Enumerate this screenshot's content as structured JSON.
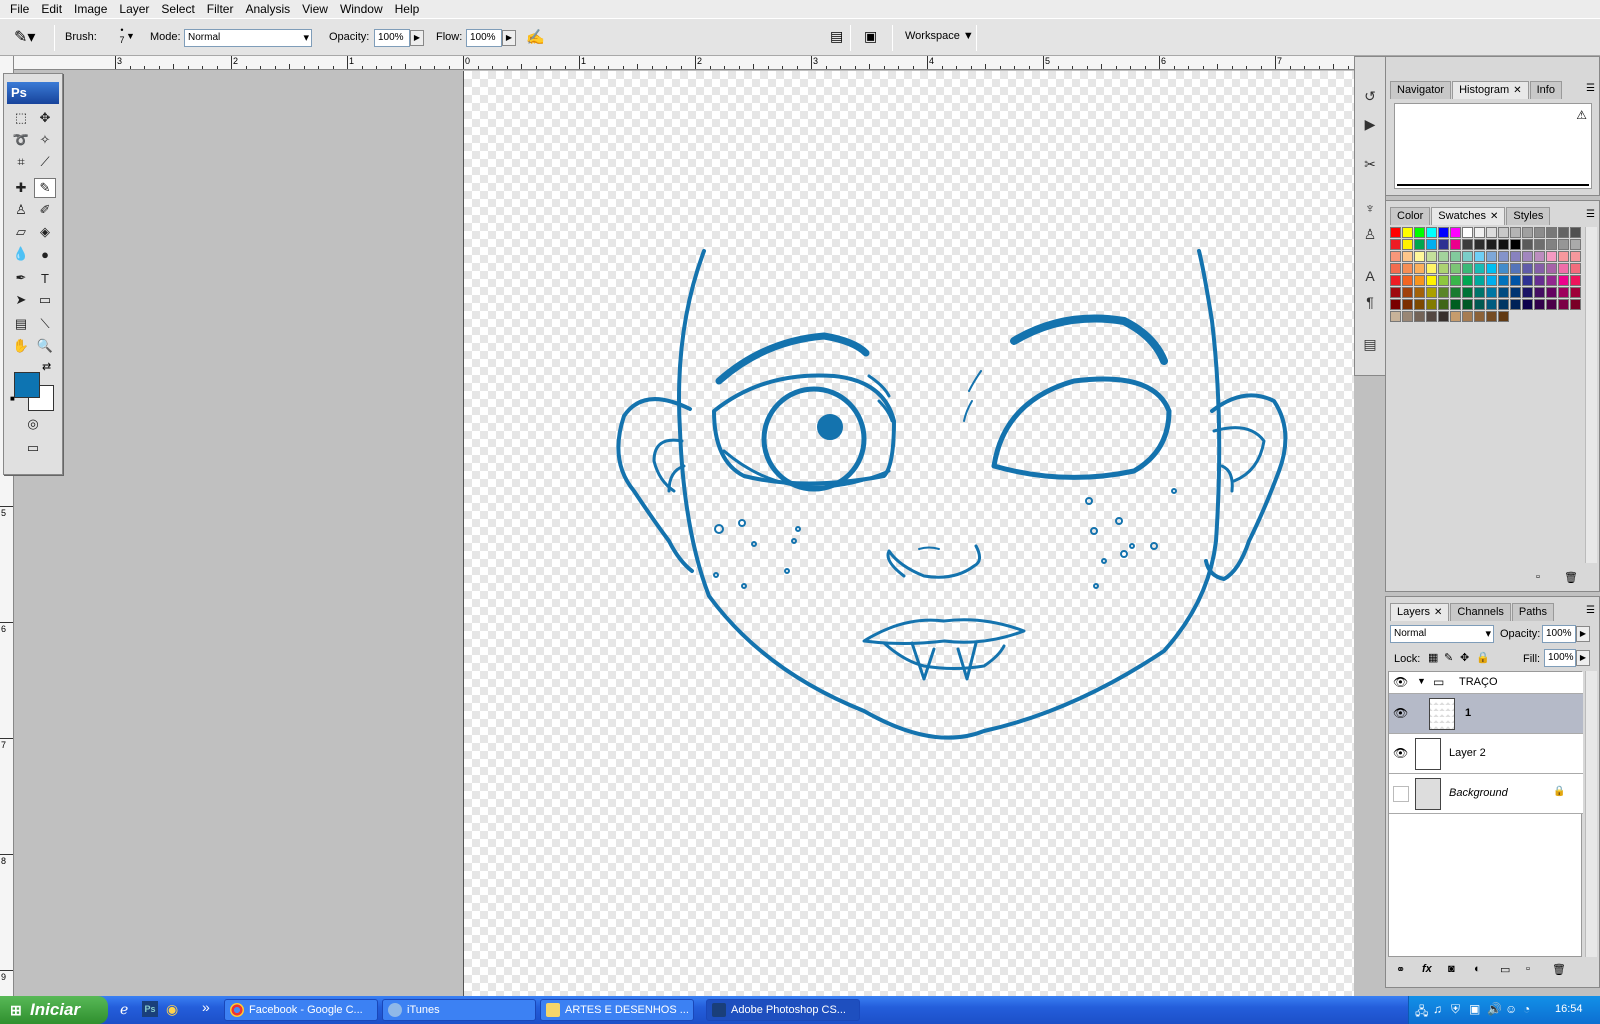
{
  "menu": [
    "File",
    "Edit",
    "Image",
    "Layer",
    "Select",
    "Filter",
    "Analysis",
    "View",
    "Window",
    "Help"
  ],
  "options": {
    "brush_label": "Brush:",
    "brush_size": "7",
    "mode_label": "Mode:",
    "mode_value": "Normal",
    "opacity_label": "Opacity:",
    "opacity_value": "100%",
    "flow_label": "Flow:",
    "flow_value": "100%",
    "workspace_label": "Workspace"
  },
  "rulers": {
    "h_labels": [
      "3",
      "2",
      "1",
      "0",
      "1",
      "2",
      "3",
      "4",
      "5",
      "6",
      "7"
    ],
    "v_labels": [
      "5",
      "6",
      "7",
      "8",
      "9"
    ]
  },
  "toolbox": {
    "logo": "Ps",
    "foreground_color": "#0d74b2",
    "background_color": "#ffffff"
  },
  "drawing": {
    "stroke_color": "#1473ae"
  },
  "panels": {
    "top_tabs": [
      "Navigator",
      "Histogram",
      "Info"
    ],
    "color_tabs": [
      "Color",
      "Swatches",
      "Styles"
    ],
    "layers_tabs": [
      "Layers",
      "Channels",
      "Paths"
    ]
  },
  "swatches": {
    "row1": [
      "#ff0000",
      "#ffff00",
      "#00ff00",
      "#00ffff",
      "#0000ff",
      "#ff00ff",
      "#ffffff",
      "#f0f0f0",
      "#dcdcdc",
      "#c8c8c8",
      "#b4b4b4",
      "#a0a0a0",
      "#8c8c8c",
      "#787878",
      "#646464",
      "#505050"
    ],
    "row2": [
      "#ee1c24",
      "#fff200",
      "#00a650",
      "#00aeef",
      "#2e3192",
      "#ec008c",
      "#3c3c3c",
      "#2d2d2d",
      "#1e1e1e",
      "#111111",
      "#000000",
      "#5a5a5a",
      "#6e6e6e",
      "#828282",
      "#969696",
      "#aaaaaa"
    ],
    "row3": [
      "#f7977a",
      "#fdc68a",
      "#fff79a",
      "#c4df9b",
      "#a3d39c",
      "#82ca9d",
      "#7bcdc8",
      "#6ecff6",
      "#7ea7d8",
      "#8493ca",
      "#8882be",
      "#a187be",
      "#bc8dbf",
      "#f49ac2",
      "#f6989d",
      "#f5989d"
    ],
    "row4": [
      "#f26c4f",
      "#f68e55",
      "#fbaf5c",
      "#fff467",
      "#acd372",
      "#7cc576",
      "#3bb878",
      "#1abbb4",
      "#00bff3",
      "#438ccb",
      "#5574b9",
      "#605ca8",
      "#855fa8",
      "#a763a8",
      "#f06ea9",
      "#f26d7d"
    ],
    "row5": [
      "#ed1c24",
      "#f26522",
      "#f7941d",
      "#fff200",
      "#8dc73f",
      "#39b54a",
      "#00a651",
      "#00a99d",
      "#00aeef",
      "#0072bc",
      "#0054a6",
      "#2e3192",
      "#662d91",
      "#92278f",
      "#ec008c",
      "#ed145b"
    ],
    "row6": [
      "#9e0b0f",
      "#a0410d",
      "#a36209",
      "#aba000",
      "#598527",
      "#1a7b30",
      "#007236",
      "#00746b",
      "#0076a3",
      "#004b80",
      "#003471",
      "#1b1464",
      "#440e62",
      "#630460",
      "#9e005d",
      "#9e0039"
    ],
    "row7": [
      "#790000",
      "#7b2e00",
      "#7d4900",
      "#827b00",
      "#406618",
      "#005e20",
      "#005826",
      "#005952",
      "#005b7f",
      "#003663",
      "#002157",
      "#0d004c",
      "#32004b",
      "#4b0049",
      "#7b0046",
      "#7a0026"
    ],
    "row8": [
      "#c7b299",
      "#998675",
      "#736357",
      "#534741",
      "#37302d",
      "#c69c6d",
      "#a67c52",
      "#8c6239",
      "#754c24",
      "#603913"
    ]
  },
  "layers": {
    "blend_mode": "Normal",
    "opacity_label": "Opacity:",
    "opacity_value": "100%",
    "lock_label": "Lock:",
    "fill_label": "Fill:",
    "fill_value": "100%",
    "items": [
      {
        "name": "TRAÇO",
        "type": "group"
      },
      {
        "name": "1",
        "type": "layer"
      },
      {
        "name": "Layer 2",
        "type": "layer"
      },
      {
        "name": "Background",
        "type": "background"
      }
    ]
  },
  "taskbar": {
    "start_label": "Iniciar",
    "windows": [
      "Facebook - Google C...",
      "iTunes",
      "ARTES E DESENHOS ...",
      "Adobe Photoshop CS..."
    ],
    "clock": "16:54"
  }
}
